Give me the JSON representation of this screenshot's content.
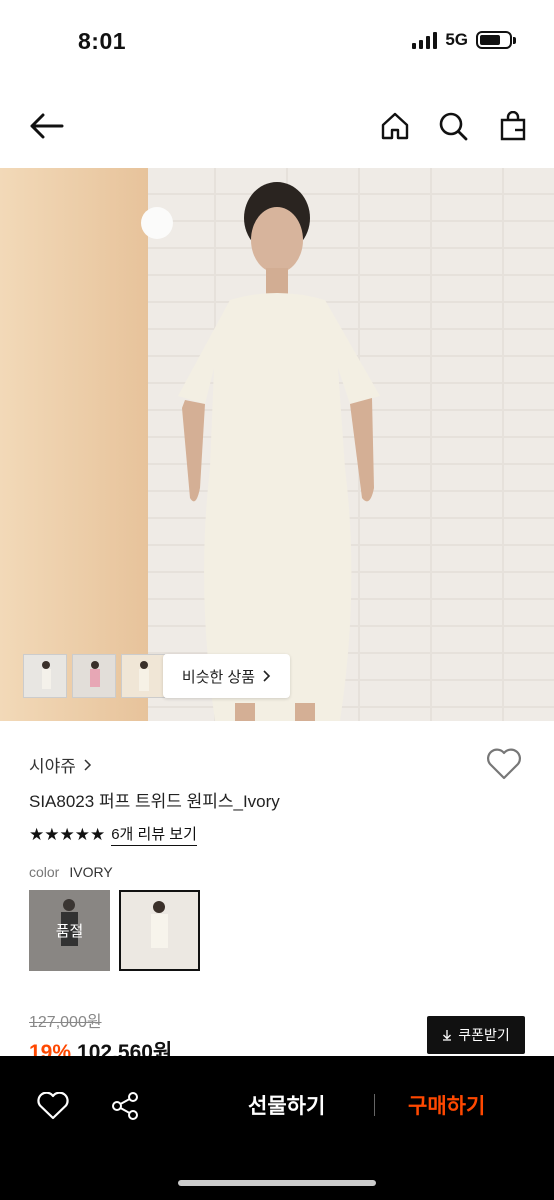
{
  "status_bar": {
    "time": "8:01",
    "network": "5G"
  },
  "nav": {
    "icons": [
      "back-arrow-icon",
      "home-icon",
      "search-icon",
      "shopping-bag-icon"
    ]
  },
  "hero": {
    "similar_button_label": "비슷한 상품"
  },
  "product": {
    "brand": "시야쥬",
    "title": "SIA8023 퍼프 트위드 원피스_Ivory",
    "stars": "★★★★★",
    "review_link": "6개 리뷰 보기",
    "color_label": "color",
    "color_value": "IVORY",
    "soldout_label": "품절",
    "original_price": "127,000원",
    "discount_rate": "19%",
    "sale_price": "102,560원",
    "coupon_button": "쿠폰받기"
  },
  "bottom_bar": {
    "gift_button": "선물하기",
    "buy_button": "구매하기"
  },
  "colors": {
    "accent": "#ff4800",
    "dark": "#000000"
  }
}
